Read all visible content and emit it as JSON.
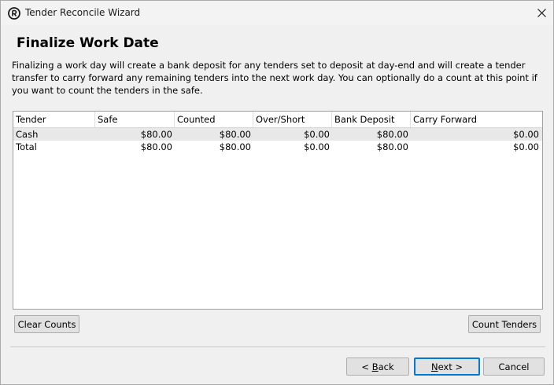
{
  "window": {
    "title": "Tender Reconcile Wizard"
  },
  "page": {
    "heading": "Finalize Work Date",
    "description": "Finalizing a work day will create a bank deposit for any tenders set to deposit at day-end and will create a tender transfer to carry forward any remaining tenders into the next work day. You can optionally do a count at this point if you want to count the tenders in the safe."
  },
  "table": {
    "columns": [
      "Tender",
      "Safe",
      "Counted",
      "Over/Short",
      "Bank Deposit",
      "Carry Forward"
    ],
    "rows": [
      [
        "Cash",
        "$80.00",
        "$80.00",
        "$0.00",
        "$80.00",
        "$0.00"
      ],
      [
        "Total",
        "$80.00",
        "$80.00",
        "$0.00",
        "$80.00",
        "$0.00"
      ]
    ]
  },
  "buttons": {
    "clear_counts": "Clear Counts",
    "count_tenders": "Count Tenders",
    "back_prefix": "< ",
    "back_accel": "B",
    "back_rest": "ack",
    "next_accel": "N",
    "next_rest": "ext >",
    "cancel": "Cancel"
  },
  "icons": {
    "app": "app-logo-icon",
    "close": "close-icon"
  },
  "colors": {
    "primary_border": "#0078d7",
    "selected_row": "#e8e8e8"
  }
}
